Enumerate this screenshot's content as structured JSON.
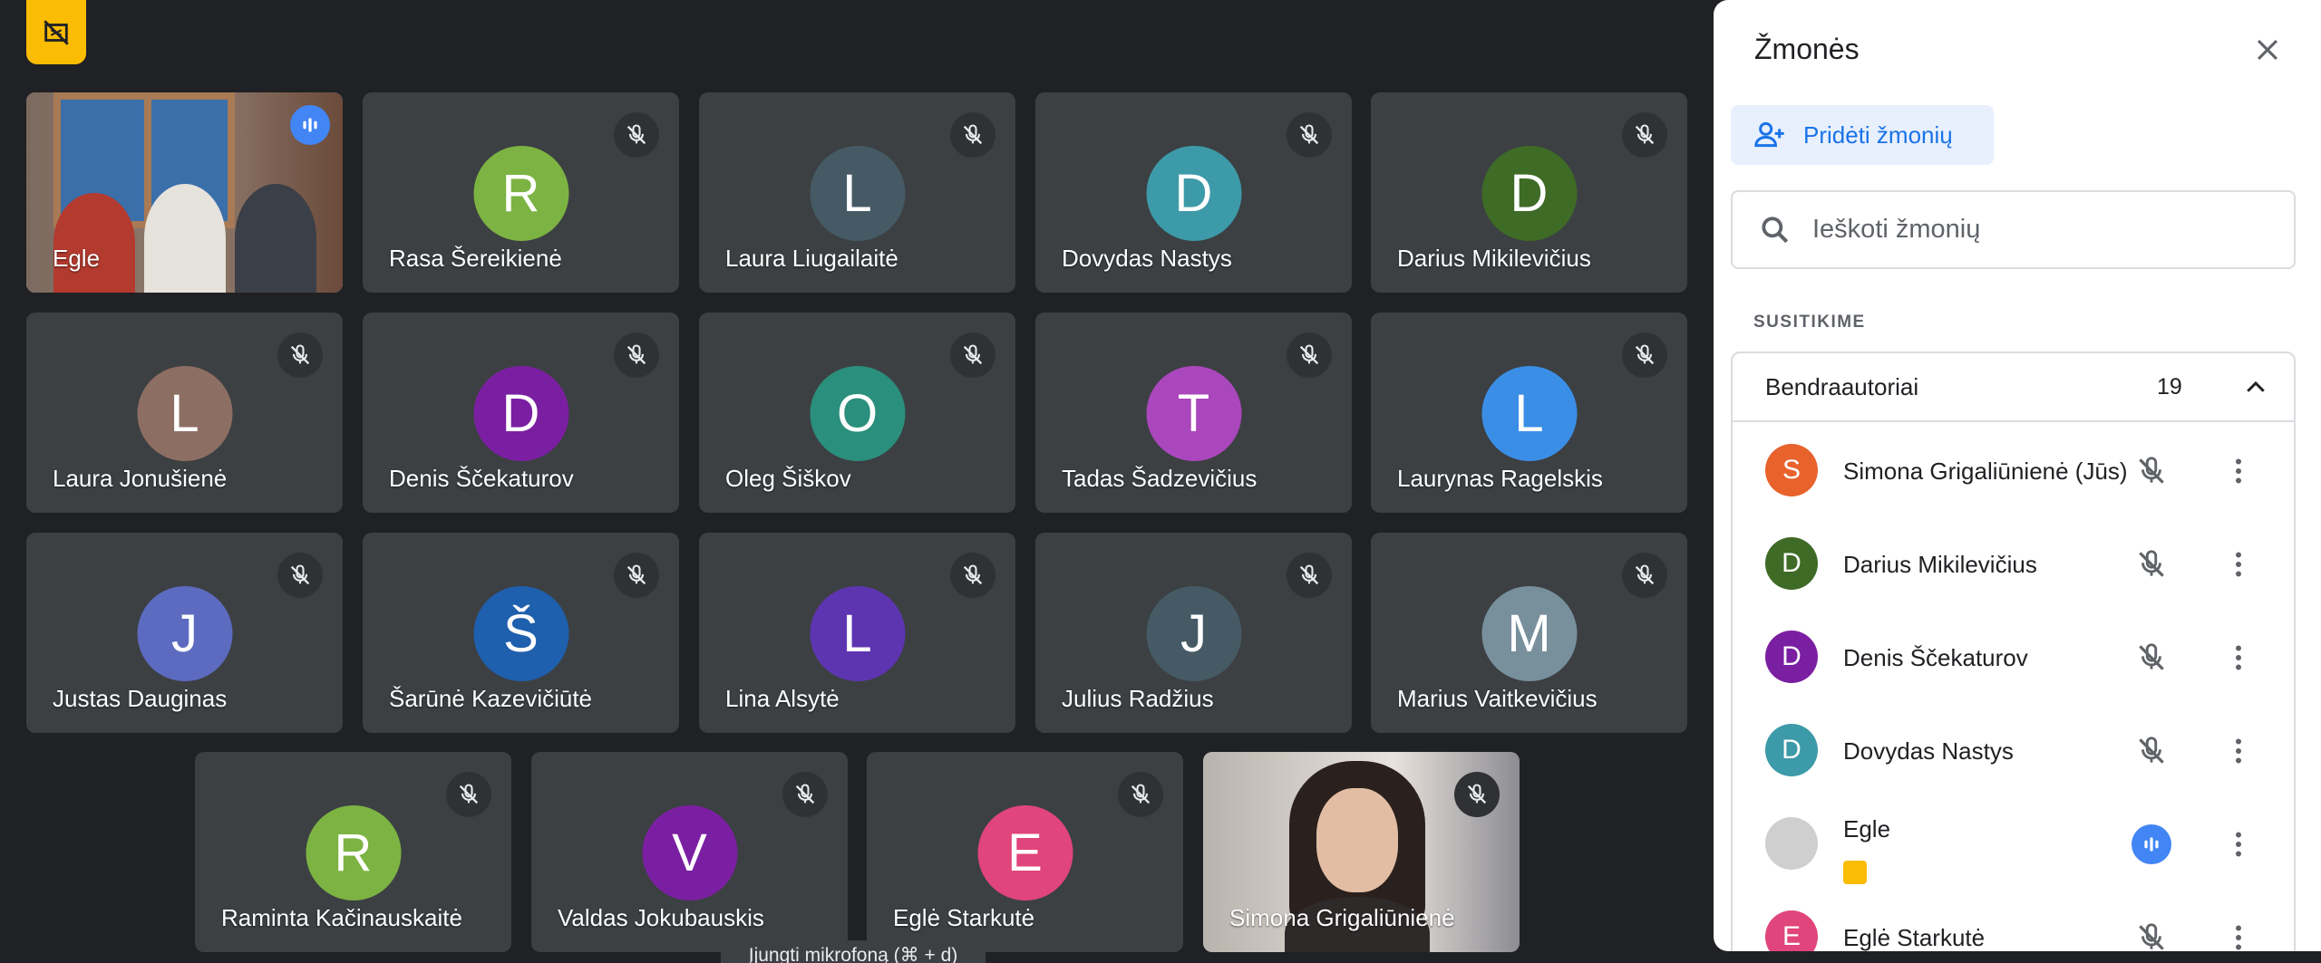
{
  "colors": {
    "background": "#202124",
    "tile": "#3c4043",
    "accent_blue": "#1a73e8",
    "speaking_blue": "#4285f4",
    "badge_yellow": "#fbbc04"
  },
  "top_badge": {
    "icon": "no-video-off-icon"
  },
  "tiles": [
    {
      "name": "Egle",
      "type": "video",
      "speaking": true
    },
    {
      "name": "Rasa Šereikienė",
      "initial": "R",
      "color": "#7cb342"
    },
    {
      "name": "Laura Liugailaitė",
      "initial": "L",
      "color": "#455a64"
    },
    {
      "name": "Dovydas Nastys",
      "initial": "D",
      "color": "#3d9aa8"
    },
    {
      "name": "Darius Mikilevičius",
      "initial": "D",
      "color": "#3e6b26"
    },
    {
      "name": "Laura Jonušienė",
      "initial": "L",
      "color": "#8d6e63"
    },
    {
      "name": "Denis Ščekaturov",
      "initial": "D",
      "color": "#7b1fa2"
    },
    {
      "name": "Oleg Šiškov",
      "initial": "O",
      "color": "#2a8f7c"
    },
    {
      "name": "Tadas Šadzevičius",
      "initial": "T",
      "color": "#ab47bc"
    },
    {
      "name": "Laurynas Ragelskis",
      "initial": "L",
      "color": "#3a8ee6"
    },
    {
      "name": "Justas Dauginas",
      "initial": "J",
      "color": "#5c6bc0"
    },
    {
      "name": "Šarūnė Kazevičiūtė",
      "initial": "Š",
      "color": "#1e5fae"
    },
    {
      "name": "Lina Alsytė",
      "initial": "L",
      "color": "#5e35b1"
    },
    {
      "name": "Julius Radžius",
      "initial": "J",
      "color": "#455a64"
    },
    {
      "name": "Marius Vaitkevičius",
      "initial": "M",
      "color": "#78909c"
    },
    {
      "name": "Raminta Kačinauskaitė",
      "initial": "R",
      "color": "#7cb342"
    },
    {
      "name": "Valdas Jokubauskis",
      "initial": "V",
      "color": "#7b1fa2"
    },
    {
      "name": "Eglė Starkutė",
      "initial": "E",
      "color": "#e0457b"
    },
    {
      "name": "Simona Grigaliūnienė",
      "type": "video"
    }
  ],
  "tooltip": "Įjungti mikrofoną (⌘ + d)",
  "panel": {
    "title": "Žmonės",
    "add_label": "Pridėti žmonių",
    "search_placeholder": "Ieškoti žmonių",
    "section_label": "SUSITIKIME",
    "group_label": "Bendraautoriai",
    "group_count": "19",
    "people": [
      {
        "name": "Simona Grigaliūnienė (Jūs)",
        "initial": "S",
        "color": "#e8622c",
        "mic": "off"
      },
      {
        "name": "Darius Mikilevičius",
        "initial": "D",
        "color": "#3e6b26",
        "mic": "off"
      },
      {
        "name": "Denis Ščekaturov",
        "initial": "D",
        "color": "#7b1fa2",
        "mic": "off"
      },
      {
        "name": "Dovydas Nastys",
        "initial": "D",
        "color": "#3d9aa8",
        "mic": "off"
      },
      {
        "name": "Egle",
        "initial": "",
        "color": "#cfcfcf",
        "mic": "speaking"
      },
      {
        "name": "Eglė Starkutė",
        "initial": "E",
        "color": "#e0457b",
        "mic": "off"
      }
    ]
  }
}
